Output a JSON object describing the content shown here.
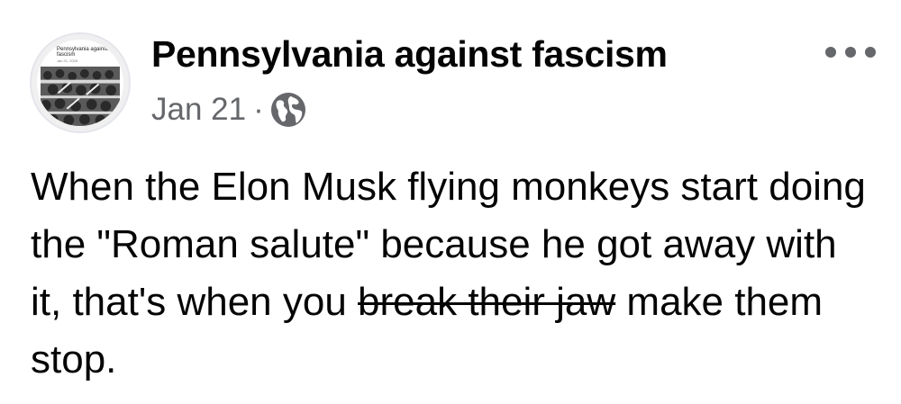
{
  "post": {
    "avatar": {
      "label_line1": "Pennsylvania against",
      "label_line2": "fascism",
      "label_line3": "Jan 21, 2025"
    },
    "page_name": "Pennsylvania against fascism",
    "date": "Jan 21",
    "separator": "·",
    "audience_icon": "globe-icon",
    "more_icon": "more-options-icon",
    "text_before": "When the Elon Musk flying monkeys start doing the \"Roman salute\" because he got away with it, that's when you ",
    "text_struck": "break their jaw",
    "text_after": " make them stop."
  },
  "colors": {
    "text": "#050505",
    "secondary": "#65676b",
    "background": "#ffffff"
  }
}
